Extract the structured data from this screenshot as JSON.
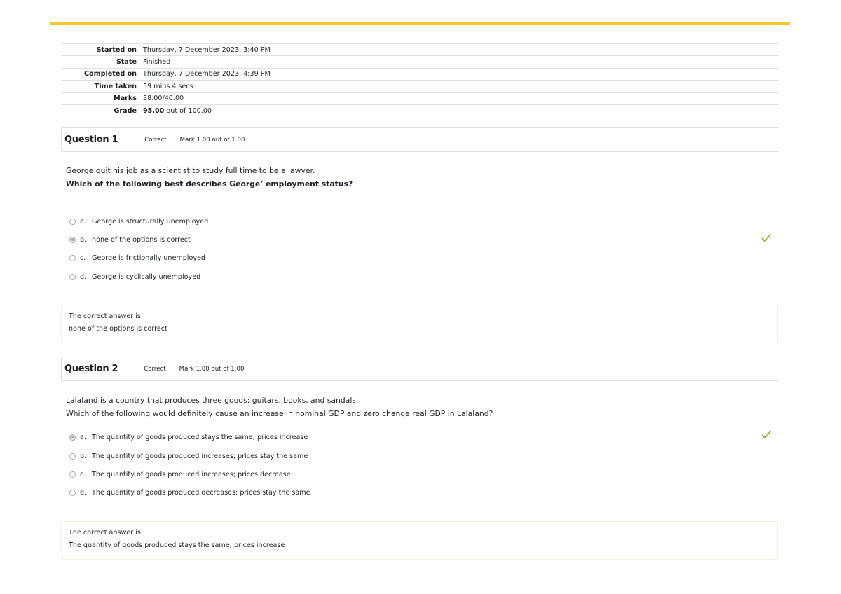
{
  "summary": [
    {
      "label": "Started on",
      "value": "Thursday, 7 December 2023, 3:40 PM"
    },
    {
      "label": "State",
      "value": "Finished"
    },
    {
      "label": "Completed on",
      "value": "Thursday, 7 December 2023, 4:39 PM"
    },
    {
      "label": "Time taken",
      "value": "59 mins 4 secs"
    },
    {
      "label": "Marks",
      "value": "38.00/40.00"
    }
  ],
  "grade": {
    "label": "Grade",
    "value": "95.00",
    "suffix": " out of 100.00"
  },
  "questions": [
    {
      "title_prefix": "Question ",
      "number": "1",
      "state": "Correct",
      "mark": "Mark 1.00 out of 1.00",
      "text_line1": "George quit his job as a scientist to study full time to be a lawyer.",
      "text_line2": "Which of the following best describes George’ employment status?",
      "options": [
        {
          "letter": "a.",
          "text": "George is structurally unemployed",
          "checked": false
        },
        {
          "letter": "b.",
          "text": "none of the options is correct",
          "checked": true
        },
        {
          "letter": "c.",
          "text": "George is frictionally unemployed",
          "checked": false
        },
        {
          "letter": "d.",
          "text": "George is cyclically unemployed",
          "checked": false
        }
      ],
      "feedback_label": "The correct answer is:",
      "feedback_answer": "none of the options is correct"
    },
    {
      "title_prefix": "Question ",
      "number": "2",
      "state": "Correct",
      "mark": "Mark 1.00 out of 1.00",
      "text_line1": "Lalaland is a country that produces three goods: guitars, books, and sandals.",
      "text_line2": "Which of the following would definitely cause an increase in nominal GDP and zero change real GDP in Lalaland?",
      "options": [
        {
          "letter": "a.",
          "text": "The quantity of goods produced stays the same; prices increase",
          "checked": true
        },
        {
          "letter": "b.",
          "text": "The quantity of goods produced increases; prices stay the same",
          "checked": false
        },
        {
          "letter": "c.",
          "text": "The quantity of goods produced increases; prices decrease",
          "checked": false
        },
        {
          "letter": "d.",
          "text": "The quantity of goods produced decreases; prices stay the same",
          "checked": false
        }
      ],
      "feedback_label": "The correct answer is:",
      "feedback_answer": "The quantity of goods produced stays the same; prices increase"
    }
  ],
  "colors": {
    "accent": "#f4c62e",
    "correct_tick": "#7eb624",
    "border": "#dee2e6"
  },
  "icons": {
    "correct": "check-icon"
  }
}
